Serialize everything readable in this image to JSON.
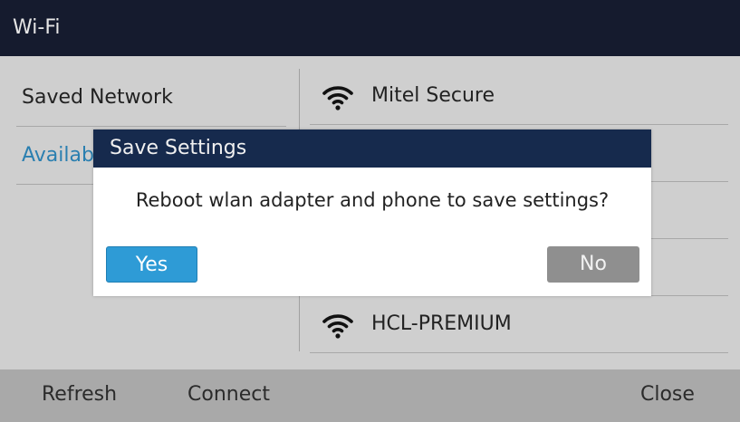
{
  "header": {
    "title": "Wi-Fi"
  },
  "left_menu": {
    "items": [
      {
        "label": "Saved Network"
      },
      {
        "label": "Available Network"
      }
    ]
  },
  "networks": [
    {
      "name": "Mitel Secure",
      "icon": "wifi-icon"
    },
    {
      "name": "HCL-PREMIUM",
      "icon": "wifi-icon"
    }
  ],
  "dialog": {
    "title": "Save Settings",
    "message": "Reboot wlan adapter and phone to save settings?",
    "yes_label": "Yes",
    "no_label": "No"
  },
  "softkeys": {
    "refresh": "Refresh",
    "connect": "Connect",
    "close": "Close"
  },
  "colors": {
    "titlebar": "#151b2e",
    "dialog_title": "#162a4d",
    "accent": "#2e9bd6",
    "active_text": "#2a7fb0"
  }
}
